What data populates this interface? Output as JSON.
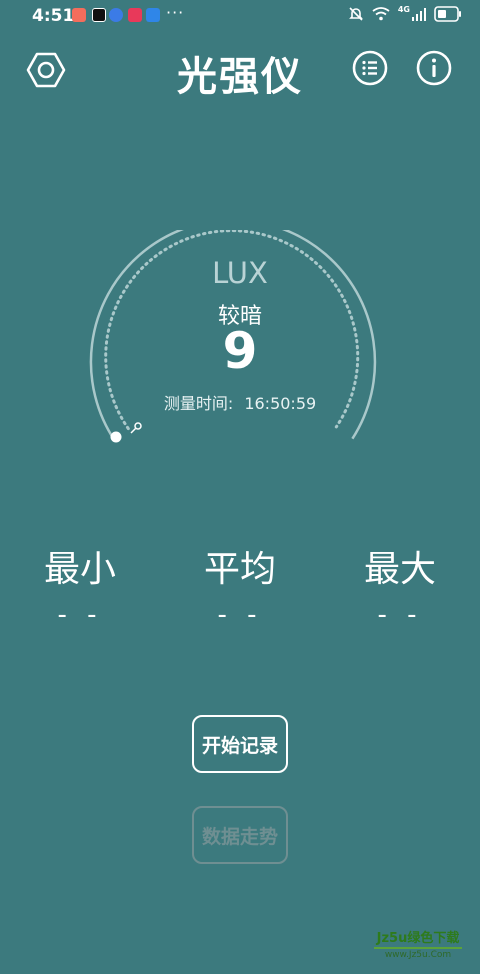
{
  "status_bar": {
    "time": "4:51",
    "more": "···",
    "network": "4G",
    "notif_colors": [
      "#f36d5c",
      "#111111",
      "#3b7be6",
      "#e8395a",
      "#2f86e8"
    ]
  },
  "header": {
    "title": "光强仪",
    "settings_icon": "hexagon-nut-icon",
    "list_icon": "list-icon",
    "info_icon": "info-icon"
  },
  "gauge": {
    "unit": "LUX",
    "level": "较暗",
    "value": "9",
    "measure_label": "测量时间:",
    "measure_time": "16:50:59",
    "level_fraction": 0.02
  },
  "stats": {
    "min": {
      "label": "最小",
      "value": "- -"
    },
    "avg": {
      "label": "平均",
      "value": "- -"
    },
    "max": {
      "label": "最大",
      "value": "- -"
    }
  },
  "buttons": {
    "start_record": "开始记录",
    "data_trend": "数据走势"
  },
  "watermark": {
    "main": "Jz5u绿色下载",
    "sub": "www.Jz5u.Com"
  },
  "colors": {
    "background": "#3c7a7e",
    "gauge_arc": "#a9c8ca",
    "disabled": "#6f8f92"
  }
}
